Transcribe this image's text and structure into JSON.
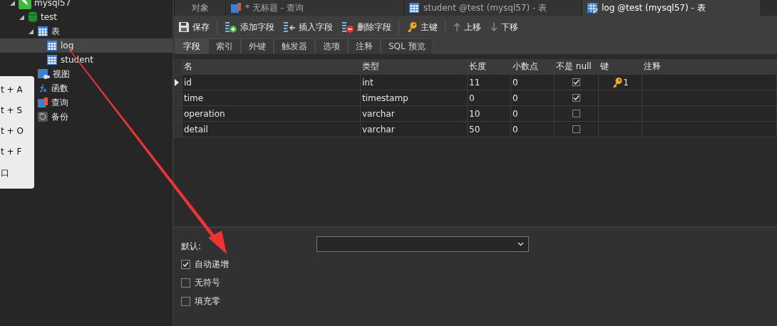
{
  "sidebar": {
    "tree": [
      {
        "label": "mysql57",
        "kind": "connection",
        "expanded": true,
        "selected": false,
        "children": [
          {
            "label": "test",
            "kind": "database",
            "expanded": true,
            "selected": false,
            "children": [
              {
                "label": "表",
                "kind": "tables",
                "expanded": true,
                "selected": false,
                "children": [
                  {
                    "label": "log",
                    "kind": "table",
                    "selected": true
                  },
                  {
                    "label": "student",
                    "kind": "table",
                    "selected": false
                  }
                ]
              },
              {
                "label": "视图",
                "kind": "view",
                "selected": false
              },
              {
                "label": "函数",
                "kind": "function",
                "selected": false
              },
              {
                "label": "查询",
                "kind": "query",
                "selected": false
              },
              {
                "label": "备份",
                "kind": "backup",
                "selected": false
              }
            ]
          }
        ]
      }
    ]
  },
  "context_menu": {
    "items": [
      "t + A",
      "t + S",
      "t + O",
      "t + F",
      "口"
    ]
  },
  "tabs": [
    {
      "label": "对象",
      "kind": "plain",
      "selected": false
    },
    {
      "label": "* 无标题 - 查询",
      "kind": "query",
      "selected": false
    },
    {
      "label": "student @test (mysql57) - 表",
      "kind": "table",
      "selected": false
    },
    {
      "label": "log @test (mysql57) - 表",
      "kind": "design",
      "selected": true
    }
  ],
  "toolbar": [
    {
      "label": "保存",
      "kind": "save"
    },
    {
      "label": "添加字段",
      "kind": "add"
    },
    {
      "label": "插入字段",
      "kind": "insert"
    },
    {
      "label": "删除字段",
      "kind": "delete"
    },
    {
      "label": "主键",
      "kind": "key"
    },
    {
      "label": "上移",
      "kind": "up"
    },
    {
      "label": "下移",
      "kind": "down"
    }
  ],
  "subtabs": [
    {
      "label": "字段",
      "selected": true
    },
    {
      "label": "索引",
      "selected": false
    },
    {
      "label": "外键",
      "selected": false
    },
    {
      "label": "触发器",
      "selected": false
    },
    {
      "label": "选项",
      "selected": false
    },
    {
      "label": "注释",
      "selected": false
    },
    {
      "label": "SQL 预览",
      "selected": false
    }
  ],
  "table": {
    "columns": [
      "名",
      "类型",
      "长度",
      "小数点",
      "不是 null",
      "键",
      "注释"
    ],
    "rows": [
      {
        "name": "id",
        "type": "int",
        "length": "11",
        "decimals": "0",
        "not_null": true,
        "key": "1",
        "selected": true
      },
      {
        "name": "time",
        "type": "timestamp",
        "length": "0",
        "decimals": "0",
        "not_null": true,
        "selected": false
      },
      {
        "name": "operation",
        "type": "varchar",
        "length": "10",
        "decimals": "0",
        "not_null": false,
        "selected": false
      },
      {
        "name": "detail",
        "type": "varchar",
        "length": "50",
        "decimals": "0",
        "not_null": false,
        "selected": false
      }
    ]
  },
  "properties": {
    "default_label": "默认:",
    "options": [
      {
        "label": "自动递增",
        "checked": true
      },
      {
        "label": "无符号",
        "checked": false
      },
      {
        "label": "填充零",
        "checked": false
      }
    ]
  }
}
